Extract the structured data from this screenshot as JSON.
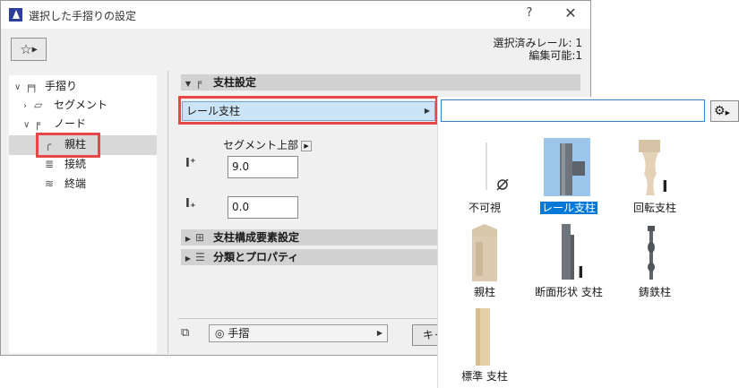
{
  "window": {
    "title": "選択した手摺りの設定",
    "help_label": "?",
    "close_label": "✕"
  },
  "selection_info": {
    "line1": "選択済みレール: 1",
    "line2": "編集可能:1"
  },
  "tree": {
    "items": [
      {
        "label": "手摺り",
        "icon": "railing-icon"
      },
      {
        "label": "セグメント",
        "icon": "segment-icon"
      },
      {
        "label": "ノード",
        "icon": "node-icon"
      },
      {
        "label": "親柱",
        "icon": "newel-post-icon"
      },
      {
        "label": "接続",
        "icon": "connection-icon"
      },
      {
        "label": "終端",
        "icon": "end-icon"
      }
    ]
  },
  "sections": {
    "post_settings": "支柱設定",
    "post_components": "支柱構成要素設定",
    "classification": "分類とプロパティ"
  },
  "post_type_select": {
    "value": "レール支柱"
  },
  "dimensions": {
    "segment_top_label": "セグメント上部",
    "height_value": "9.0",
    "offset_value": "0.0"
  },
  "footer": {
    "layer_value": "手摺",
    "cancel_label": "キャンセル"
  },
  "popup": {
    "search_value": "",
    "tiles": [
      {
        "label": "不可視",
        "icon": "invisible-post-icon"
      },
      {
        "label": "レール支柱",
        "icon": "rail-post-icon",
        "selected": true
      },
      {
        "label": "回転支柱",
        "icon": "turned-post-icon"
      },
      {
        "label": "親柱",
        "icon": "newel-post-icon"
      },
      {
        "label": "断面形状 支柱",
        "icon": "profile-post-icon"
      },
      {
        "label": "鋳鉄柱",
        "icon": "cast-iron-post-icon"
      },
      {
        "label": "標準 支柱",
        "icon": "standard-post-icon"
      }
    ]
  },
  "colors": {
    "highlight_red": "#e8474a",
    "selection_blue": "#0078d7",
    "select_bg": "#cce4f7"
  }
}
